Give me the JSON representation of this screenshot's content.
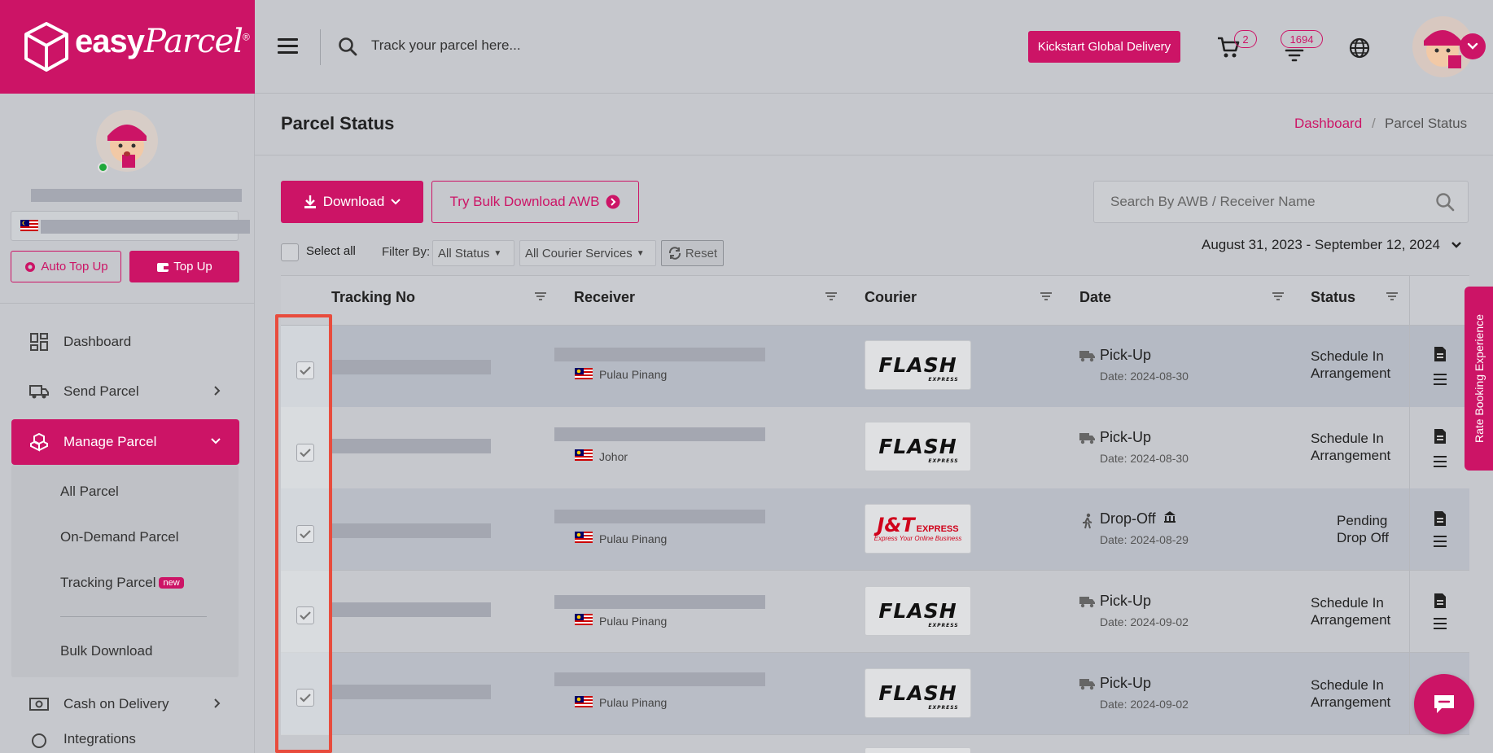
{
  "brand": {
    "name": "easy",
    "name_italic": "Parcel",
    "reg": "®",
    "color": "#cc1466"
  },
  "topbar": {
    "track_placeholder": "Track your parcel here...",
    "kickstart_label": "Kickstart Global Delivery",
    "cart_count": "2",
    "notif_count": "1694"
  },
  "sidebar": {
    "auto_topup_label": "Auto Top Up",
    "topup_label": "Top Up",
    "nav": [
      {
        "label": "Dashboard",
        "icon": "dashboard-icon"
      },
      {
        "label": "Send Parcel",
        "icon": "truck-icon"
      },
      {
        "label": "Manage Parcel",
        "icon": "boxes-icon"
      },
      {
        "label": "Cash on Delivery",
        "icon": "cash-icon"
      },
      {
        "label": "Integrations",
        "icon": "integrations-icon"
      }
    ],
    "sub": [
      {
        "label": "All Parcel"
      },
      {
        "label": "On-Demand Parcel"
      },
      {
        "label": "Tracking Parcel",
        "badge": "new"
      },
      {
        "label": "Bulk Download"
      }
    ]
  },
  "page": {
    "title": "Parcel Status",
    "breadcrumb": {
      "home": "Dashboard",
      "sep": "/",
      "current": "Parcel Status"
    },
    "download_label": "Download",
    "bulk_label": "Try Bulk Download AWB",
    "awb_placeholder": "Search By AWB / Receiver Name",
    "select_all": "Select all",
    "filter_by": "Filter By:",
    "status_filter": "All Status",
    "courier_filter": "All Courier Services",
    "reset": "Reset",
    "date_range": "August 31, 2023 - September 12, 2024"
  },
  "table": {
    "headers": [
      "Tracking No",
      "Receiver",
      "Courier",
      "Date",
      "Status"
    ],
    "rows": [
      {
        "state": "Pulau Pinang",
        "courier": "flash",
        "method": "Pick-Up",
        "date": "Date: 2024-08-30",
        "status1": "Schedule In",
        "status2": "Arrangement",
        "checked": true
      },
      {
        "state": "Johor",
        "courier": "flash",
        "method": "Pick-Up",
        "date": "Date: 2024-08-30",
        "status1": "Schedule In",
        "status2": "Arrangement",
        "checked": true
      },
      {
        "state": "Pulau Pinang",
        "courier": "jt",
        "method": "Drop-Off",
        "date": "Date: 2024-08-29",
        "status1": "Pending",
        "status2": "Drop Off",
        "checked": true
      },
      {
        "state": "Pulau Pinang",
        "courier": "flash",
        "method": "Pick-Up",
        "date": "Date: 2024-09-02",
        "status1": "Schedule In",
        "status2": "Arrangement",
        "checked": true
      },
      {
        "state": "Pulau Pinang",
        "courier": "flash",
        "method": "Pick-Up",
        "date": "Date: 2024-09-02",
        "status1": "Schedule In",
        "status2": "Arrangement",
        "checked": true
      }
    ]
  },
  "courier_logos": {
    "flash": {
      "main": "FLASH",
      "sub": "EXPRESS"
    },
    "jt": {
      "main": "J&T",
      "sub": "EXPRESS",
      "tag": "Express Your Online Business"
    }
  },
  "side_tab": "Rate Booking Experience"
}
